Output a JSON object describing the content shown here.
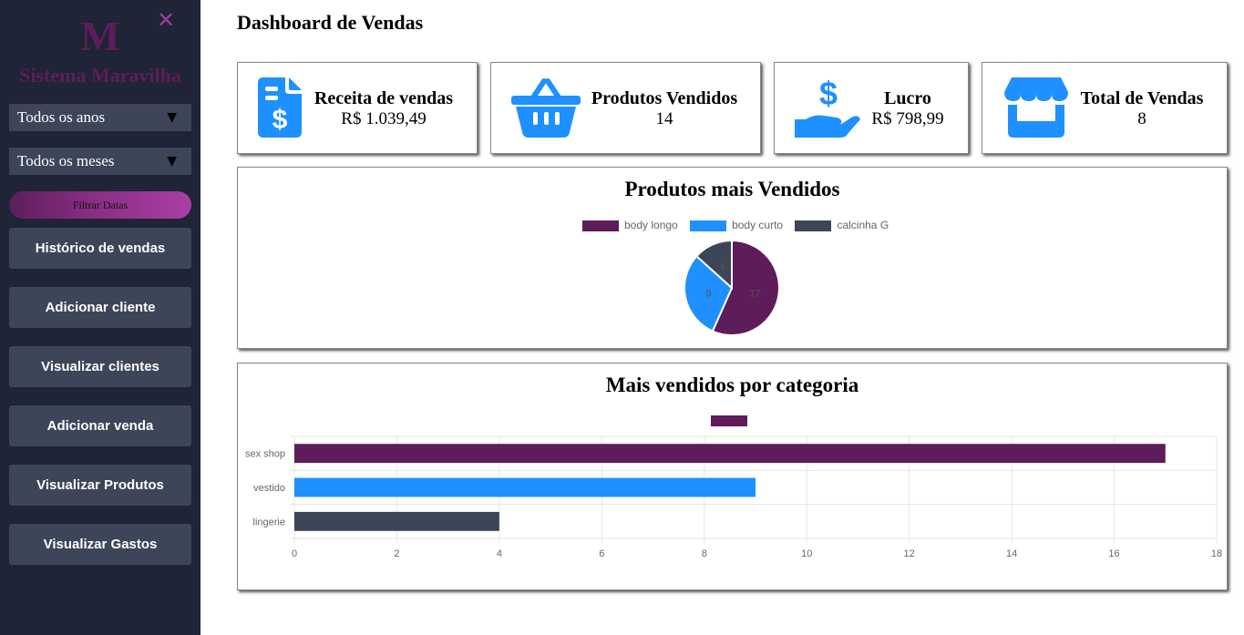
{
  "sidebar": {
    "logo_letter": "M",
    "close_glyph": "✕",
    "brand": "Sistema Maravilha",
    "year_select": "Todos os anos",
    "month_select": "Todos os meses",
    "select_arrow": "▼",
    "filter_button": "Filtrar Datas",
    "nav": [
      {
        "label": "Histórico de vendas"
      },
      {
        "label": "Adicionar cliente"
      },
      {
        "label": "Visualizar clientes"
      },
      {
        "label": "Adicionar venda"
      },
      {
        "label": "Visualizar Produtos"
      },
      {
        "label": "Visualizar Gastos"
      }
    ],
    "colors": {
      "background": "#1f2437",
      "button": "#3d4559",
      "brand": "#5e1c5a"
    }
  },
  "main": {
    "title": "Dashboard de Vendas",
    "cards": [
      {
        "title": "Receita de vendas",
        "value": "R$ 1.039,49",
        "icon": "invoice-dollar-icon"
      },
      {
        "title": "Produtos Vendidos",
        "value": "14",
        "icon": "shopping-basket-icon"
      },
      {
        "title": "Lucro",
        "value": "R$ 798,99",
        "icon": "hand-dollar-icon"
      },
      {
        "title": "Total de Vendas",
        "value": "8",
        "icon": "store-icon"
      }
    ],
    "icon_color": "#1e90ff"
  },
  "chart_data": [
    {
      "type": "pie",
      "title": "Produtos mais Vendidos",
      "labels": [
        "body longo",
        "body curto",
        "calcinha G"
      ],
      "values": [
        17,
        9,
        4
      ],
      "colors": [
        "#5e1c5a",
        "#1e90ff",
        "#3d4559"
      ],
      "legend": "top"
    },
    {
      "type": "bar",
      "orientation": "horizontal",
      "title": "Mais vendidos por categoria",
      "categories": [
        "sex shop",
        "vestido",
        "lingerie"
      ],
      "values": [
        17,
        9,
        4
      ],
      "colors": [
        "#5e1c5a",
        "#1e90ff",
        "#3d4559"
      ],
      "xlim": [
        0,
        18
      ],
      "xticks": [
        "0",
        "2",
        "4",
        "6",
        "8",
        "10",
        "12",
        "14",
        "16",
        "18"
      ],
      "grid": true,
      "legend": "top"
    }
  ]
}
